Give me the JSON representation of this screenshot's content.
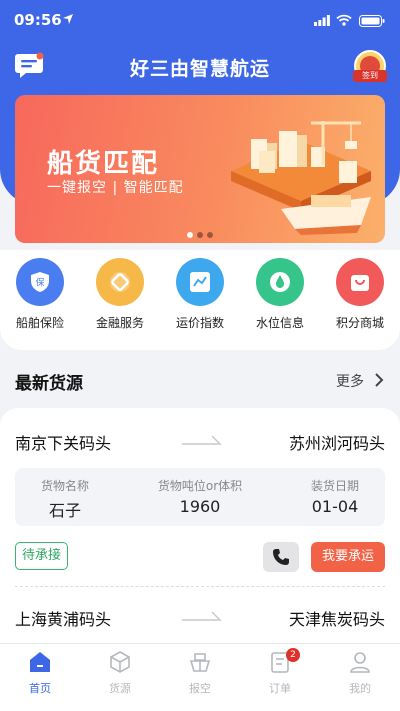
{
  "status_bar": {
    "time": "09:56"
  },
  "header": {
    "title": "好三由智慧航运",
    "checkin_label": "签到"
  },
  "banner": {
    "title": "船货匹配",
    "subtitle": "一键报空 | 智能匹配",
    "slides": 3,
    "active_slide": 1
  },
  "quick_menu": [
    {
      "label": "船舶保险",
      "icon": "shield-icon",
      "color": "#4a7df0"
    },
    {
      "label": "金融服务",
      "icon": "coin-icon",
      "color": "#f7b84a"
    },
    {
      "label": "运价指数",
      "icon": "chart-icon",
      "color": "#3ea8ee"
    },
    {
      "label": "水位信息",
      "icon": "water-drop-icon",
      "color": "#35c489"
    },
    {
      "label": "积分商城",
      "icon": "shopping-bag-icon",
      "color": "#f25a5a"
    }
  ],
  "section": {
    "title": "最新货源",
    "more_label": "更多"
  },
  "cargo_list": [
    {
      "from": "南京下关码头",
      "to": "苏州浏河码头",
      "goods_label": "货物名称",
      "goods": "石子",
      "tonnage_label": "货物吨位or体积",
      "tonnage": "1960",
      "date_label": "装货日期",
      "date": "01-04",
      "status": "待承接",
      "action_label": "我要承运"
    },
    {
      "from": "上海黄浦码头",
      "to": "天津焦炭码头"
    }
  ],
  "tabbar": [
    {
      "label": "首页",
      "icon": "home-icon",
      "active": true
    },
    {
      "label": "货源",
      "icon": "box-icon"
    },
    {
      "label": "报空",
      "icon": "ship-icon"
    },
    {
      "label": "订单",
      "icon": "order-icon",
      "badge": "2"
    },
    {
      "label": "我的",
      "icon": "user-icon"
    }
  ]
}
